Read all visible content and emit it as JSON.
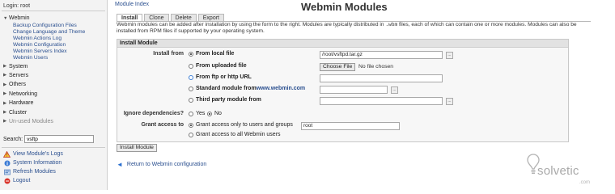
{
  "sidebar": {
    "login": "Login: root",
    "webmin_label": "Webmin",
    "webmin_items": [
      "Backup Configuration Files",
      "Change Language and Theme",
      "Webmin Actions Log",
      "Webmin Configuration",
      "Webmin Servers Index",
      "Webmin Users"
    ],
    "categories": [
      "System",
      "Servers",
      "Others",
      "Networking",
      "Hardware",
      "Cluster",
      "Un-used Modules"
    ],
    "search_label": "Search:",
    "search_value": "vsftp",
    "links": [
      {
        "label": "View Module's Logs",
        "icon": "warning-icon"
      },
      {
        "label": "System Information",
        "icon": "info-icon"
      },
      {
        "label": "Refresh Modules",
        "icon": "refresh-icon"
      },
      {
        "label": "Logout",
        "icon": "logout-icon"
      }
    ]
  },
  "header": {
    "module_index": "Module Index",
    "title": "Webmin Modules"
  },
  "tabs": [
    "Install",
    "Clone",
    "Delete",
    "Export"
  ],
  "intro": {
    "part1": "Webmin modules can be added after installation by using the form to the right. Modules are typically distributed in ",
    "code": ".wbm",
    "part2": " files, each of which can contain one or more modules. Modules can also be installed from RPM files if supported by your operating system."
  },
  "install": {
    "header": "Install Module",
    "install_from_label": "Install from",
    "options": {
      "local": "From local file",
      "uploaded": "From uploaded file",
      "ftp": "From ftp or http URL",
      "standard_prefix": "Standard module from ",
      "standard_link": "www.webmin.com",
      "third_party": "Third party module from"
    },
    "local_path": "/root/vsftpd.tar.gz",
    "choose_file": "Choose File",
    "no_file": "No file chosen",
    "ignore_label": "Ignore dependencies?",
    "yes": "Yes",
    "no": "No",
    "grant_label": "Grant access to",
    "grant_only": "Grant access only to users and groups",
    "grant_users_value": "root",
    "grant_all": "Grant access to all Webmin users",
    "button": "Install Module"
  },
  "footer": {
    "return": "Return to Webmin configuration"
  },
  "watermark": {
    "text": "solvetic",
    "domain": ".com"
  },
  "colors": {
    "link": "#2a4f8f",
    "sidebar_bg": "#f3f3f3"
  }
}
